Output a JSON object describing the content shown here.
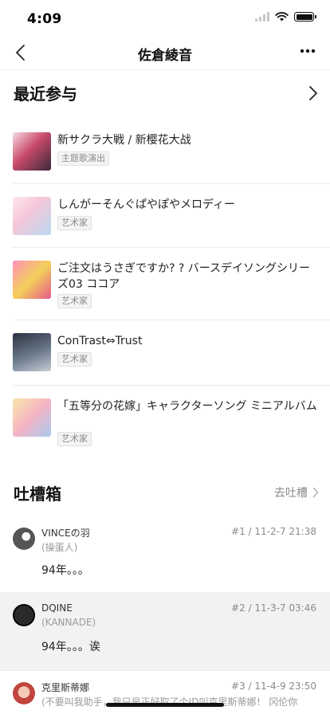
{
  "status_bar": {
    "time": "4:09"
  },
  "nav": {
    "title": "佐倉綾音"
  },
  "recent": {
    "title": "最近参与",
    "items": [
      {
        "title": "新サクラ大戦 / 新樱花大战",
        "tag": "主题歌演出"
      },
      {
        "title": "しんがーそんぐぱやぽやメロディー",
        "tag": "艺术家"
      },
      {
        "title": "ご注文はうさぎですか? ? バースデイソングシリーズ03 ココア",
        "tag": "艺术家"
      },
      {
        "title": "ConTrast⇔Trust",
        "tag": "艺术家"
      },
      {
        "title": "「五等分の花嫁」キャラクターソング ミニアルバム",
        "tag": "艺术家"
      }
    ]
  },
  "comments": {
    "title": "吐槽箱",
    "go_label": "去吐槽",
    "items": [
      {
        "name": "VINCEの羽",
        "sub": "(操蛋人)",
        "meta": "#1 / 11-2-7 21:38",
        "text": "94年。。。"
      },
      {
        "name": "DQINE",
        "sub": "(KANNADE)",
        "meta": "#2 / 11-3-7 03:46",
        "text": "94年。。。诶"
      },
      {
        "name": "克里斯蒂娜",
        "sub": "(不要叫我助手，我只是正好取了个ID叫克里斯蒂娜！ 冈伦你",
        "meta": "#3 / 11-4-9 23:50",
        "text": ""
      }
    ]
  },
  "colors": {
    "accent": "#111111",
    "muted": "#8a8a8a",
    "divider": "#ececec",
    "shaded_row": "#f2f2f2"
  }
}
